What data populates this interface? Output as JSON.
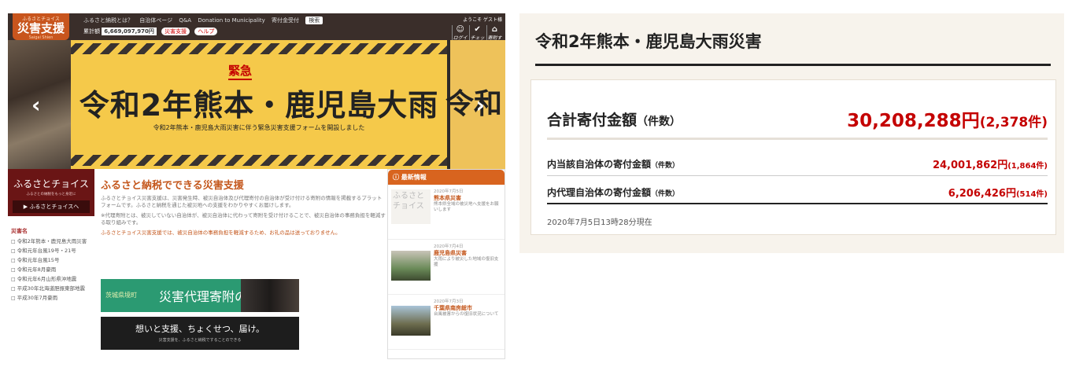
{
  "site": {
    "logo": {
      "small": "ふるさとチョイス",
      "big": "災害支援",
      "sub": "Saigai Shien"
    },
    "top_links": [
      "ふるさと納税とは？",
      "自治体ページ",
      "Q&A",
      "Donation to Municipality",
      "寄付金受付"
    ],
    "search_placeholder": "検索",
    "total_label": "累計額",
    "total_amount": "6,669,097,970円",
    "pill_1": "災害支援",
    "pill_2": "ヘルプ",
    "user": {
      "welcome": "ようこそ ゲスト様",
      "icons": [
        {
          "glyph": "☺",
          "label": "ログイン"
        },
        {
          "glyph": "✔",
          "label": "チェック"
        },
        {
          "glyph": "⌂",
          "label": "寄附する"
        }
      ]
    },
    "hero": {
      "urgent": "緊急",
      "headline": "令和2年熊本・鹿児島大雨",
      "subline": "令和2年熊本・鹿児島大雨災害に伴う緊急災害支援フォームを開設しました",
      "next_slide": "令和",
      "prev": "‹",
      "next": "›"
    },
    "sidebar": {
      "brand": "ふるさとチョイス",
      "brand_desc": "ふるさとの納税をもっと身近に",
      "brand_button": "▶ ふるさとチョイスへ",
      "cat_title": "災害名",
      "categories": [
        "令和2年熊本・鹿児島大雨災害",
        "令和元年台風19号・21号",
        "令和元年台風15号",
        "令和元年8月豪雨",
        "令和元年6月山形県沖地震",
        "平成30年北海道胆振東部地震",
        "平成30年7月豪雨"
      ]
    },
    "main": {
      "title": "ふるさと納税でできる災害支援",
      "text_1": "ふるさとチョイス災害支援は、災害発生時、被災自治体及び代理寄付の自治体が受け付ける寄附の情報を掲載するプラットフォームです。ふるさと納税を通じた被災地への支援をわかりやすくお届けします。",
      "text_2": "※代理寄附とは、被災していない自治体が、被災自治体に代わって寄附を受け付けることで、被災自治体の事務負担を軽減する取り組みです。",
      "text_3": "ふるさとチョイス災害支援では、被災自治体の事務負担を軽減するため、お礼の品は送っておりません。",
      "ad1_a": "茨城県境町",
      "ad1_b": "災害代理寄附のはじまり",
      "ad2_a": "想いと支援、ちょくせつ、届け。",
      "ad2_b": "災害支援を、ふるさと納税ですることのできる"
    },
    "news": {
      "head": "ⓘ 最新情報",
      "items": [
        {
          "thumb": "ふるさとチョイス",
          "date": "2020年7月5日",
          "title": "熊本県災害",
          "body": "熊本県全域の被災地へ支援をお願いします"
        },
        {
          "thumb": "",
          "date": "2020年7月4日",
          "title": "鹿児島県災害",
          "body": "大雨により被災した地域の復旧支援"
        },
        {
          "thumb": "",
          "date": "2020年7月3日",
          "title": "千葉県南房総市",
          "body": "台風被害からの復旧状況について"
        }
      ]
    }
  },
  "card": {
    "title": "令和2年熊本・鹿児島大雨災害",
    "total": {
      "label": "合計寄付金額",
      "label_count": "（件数）",
      "value": "30,208,288円",
      "count": "(2,378件)"
    },
    "rows": [
      {
        "label": "内当該自治体の寄付金額",
        "label_count": "（件数）",
        "value": "24,001,862円",
        "count": "(1,864件)"
      },
      {
        "label": "内代理自治体の寄付金額",
        "label_count": "（件数）",
        "value": "6,206,426円",
        "count": "(514件)"
      }
    ],
    "as_of": "2020年7月5日13時28分現在"
  }
}
